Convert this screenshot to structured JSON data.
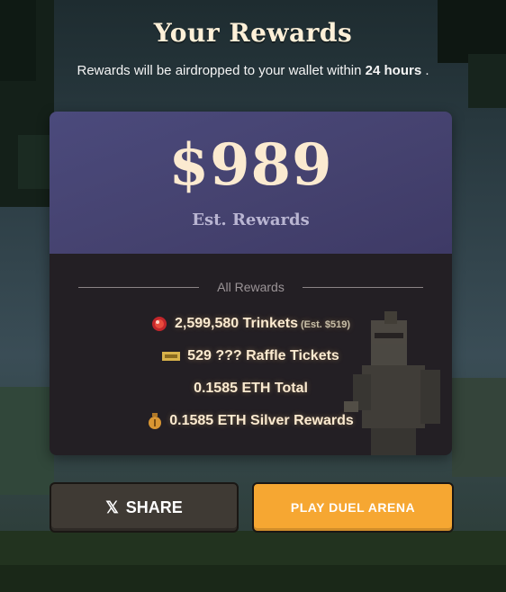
{
  "header": {
    "title": "Your Rewards",
    "subtitle_prefix": "Rewards will be airdropped to your wallet within",
    "subtitle_bold": "24 hours",
    "subtitle_suffix": "."
  },
  "summary": {
    "amount": "$989",
    "label": "Est. Rewards"
  },
  "rewards": {
    "section_label": "All Rewards",
    "items": [
      {
        "icon": "trinket-gem-icon",
        "text": "2,599,580 Trinkets",
        "note": "(Est. $519)"
      },
      {
        "icon": "raffle-ticket-icon",
        "text": "529 ??? Raffle Tickets"
      },
      {
        "text": "0.1585 ETH Total"
      },
      {
        "icon": "money-bag-icon",
        "text": "0.1585 ETH Silver Rewards"
      }
    ]
  },
  "actions": {
    "share_label": "SHARE",
    "share_icon": "x-logo-icon",
    "play_label": "PLAY DUEL ARENA"
  },
  "colors": {
    "accent_orange": "#f6a732",
    "card_top": "#45426f",
    "card_bottom": "#231f24",
    "text_cream": "#fbead0"
  }
}
